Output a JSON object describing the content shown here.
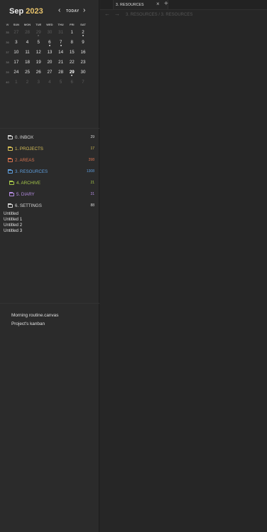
{
  "calendar": {
    "month": "Sep",
    "year": "2023",
    "today_label": "TODAY",
    "prev_icon": "‹",
    "next_icon": "›",
    "headers": [
      "W",
      "SUN",
      "MON",
      "TUE",
      "WED",
      "THU",
      "FRI",
      "SAT"
    ],
    "weeks": [
      {
        "wk": "35",
        "days": [
          "27",
          "28",
          "29",
          "30",
          "31",
          "1",
          "2"
        ]
      },
      {
        "wk": "36",
        "days": [
          "3",
          "4",
          "5",
          "6",
          "7",
          "8",
          "9"
        ]
      },
      {
        "wk": "37",
        "days": [
          "10",
          "11",
          "12",
          "13",
          "14",
          "15",
          "16"
        ]
      },
      {
        "wk": "38",
        "days": [
          "17",
          "18",
          "19",
          "20",
          "21",
          "22",
          "23"
        ]
      },
      {
        "wk": "39",
        "days": [
          "24",
          "25",
          "26",
          "27",
          "28",
          "29",
          "30"
        ]
      },
      {
        "wk": "40",
        "days": [
          "1",
          "2",
          "3",
          "4",
          "5",
          "6",
          "7"
        ]
      }
    ]
  },
  "folders": [
    {
      "label": "0. INBOX",
      "count": "29",
      "color": "#d8d8d8"
    },
    {
      "label": "1. PROJECTS",
      "count": "17",
      "color": "#d7c057"
    },
    {
      "label": "2. AREAS",
      "count": "398",
      "color": "#d9734f"
    },
    {
      "label": "3. RESOURCES",
      "count": "1308",
      "color": "#5f9fde"
    },
    {
      "label": "4. ARCHIVE",
      "count": "21",
      "color": "#a7c94a"
    },
    {
      "label": "5. DIARY",
      "count": "31",
      "color": "#b38be0"
    },
    {
      "label": "6. SETTINGS",
      "count": "88",
      "color": "#d8d8d8"
    }
  ],
  "untitled": [
    "Untitled",
    "Untitled 1",
    "Untitled 2",
    "Untitled 3"
  ],
  "bookmarks": [
    "Morning routine.canvas",
    "Project's kanban"
  ],
  "tab": {
    "label": "3. RESOURCES",
    "close": "×",
    "new": "+"
  },
  "nav": {
    "back": "←",
    "forward": "→"
  },
  "breadcrumb": "3. RESOURCES / 3. RESOURCES"
}
